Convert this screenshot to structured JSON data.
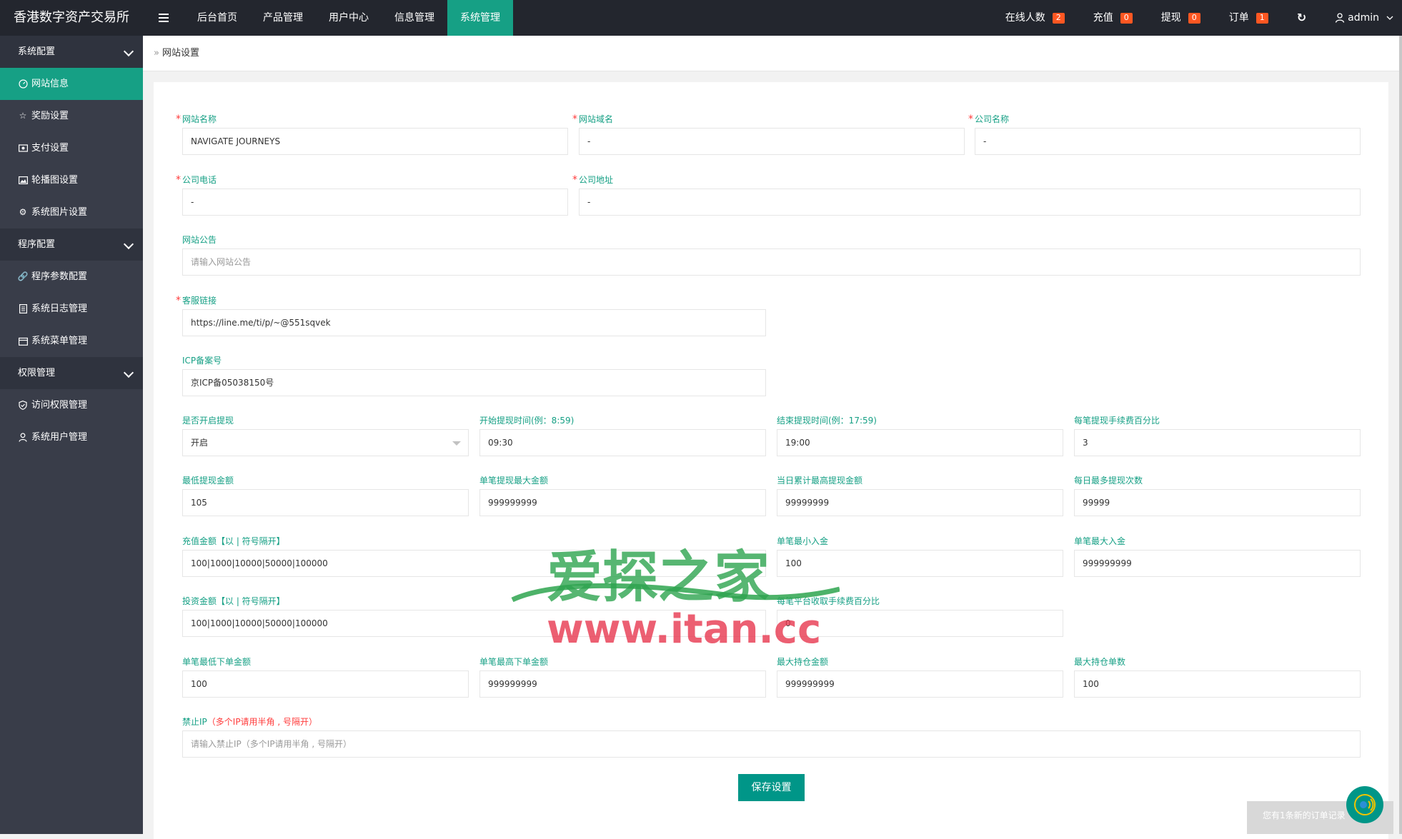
{
  "app": {
    "title": "香港数字资产交易所"
  },
  "topnav": {
    "items": [
      {
        "label": "后台首页"
      },
      {
        "label": "产品管理"
      },
      {
        "label": "用户中心"
      },
      {
        "label": "信息管理"
      },
      {
        "label": "系统管理",
        "active": true
      }
    ]
  },
  "topright": {
    "online": {
      "label": "在线人数",
      "count": "2"
    },
    "recharge": {
      "label": "充值",
      "count": "0"
    },
    "withdraw": {
      "label": "提现",
      "count": "0"
    },
    "orders": {
      "label": "订单",
      "count": "1"
    },
    "user": "admin"
  },
  "sidebar": {
    "groups": [
      {
        "label": "系统配置",
        "items": [
          "网站信息",
          "奖励设置",
          "支付设置",
          "轮播图设置",
          "系统图片设置"
        ]
      },
      {
        "label": "程序配置",
        "items": [
          "程序参数配置",
          "系统日志管理",
          "系统菜单管理"
        ]
      },
      {
        "label": "权限管理",
        "items": [
          "访问权限管理",
          "系统用户管理"
        ]
      }
    ]
  },
  "breadcrumb": "网站设置",
  "form": {
    "site_name": {
      "label": "网站名称",
      "value": "NAVIGATE JOURNEYS"
    },
    "site_domain": {
      "label": "网站域名",
      "value": "-"
    },
    "company_name": {
      "label": "公司名称",
      "value": "-"
    },
    "company_phone": {
      "label": "公司电话",
      "value": "-"
    },
    "company_address": {
      "label": "公司地址",
      "value": "-"
    },
    "announcement": {
      "label": "网站公告",
      "placeholder": "请输入网站公告"
    },
    "service_link": {
      "label": "客服链接",
      "value": "https://line.me/ti/p/~@551sqvek"
    },
    "icp": {
      "label": "ICP备案号",
      "value": "京ICP备05038150号"
    },
    "withdraw_enabled": {
      "label": "是否开启提现",
      "value": "开启"
    },
    "withdraw_start": {
      "label": "开始提现时间(例：8:59)",
      "value": "09:30"
    },
    "withdraw_end": {
      "label": "结束提现时间(例：17:59)",
      "value": "19:00"
    },
    "withdraw_fee": {
      "label": "每笔提现手续费百分比",
      "value": "3"
    },
    "min_withdraw": {
      "label": "最低提现金额",
      "value": "105"
    },
    "max_withdraw": {
      "label": "单笔提现最大金额",
      "value": "999999999"
    },
    "daily_max_withdraw": {
      "label": "当日累计最高提现金额",
      "value": "99999999"
    },
    "daily_withdraw_count": {
      "label": "每日最多提现次数",
      "value": "99999"
    },
    "recharge_amounts": {
      "label": "充值金额【以 | 符号隔开】",
      "value": "100|1000|10000|50000|100000"
    },
    "min_deposit": {
      "label": "单笔最小入金",
      "value": "100"
    },
    "max_deposit": {
      "label": "单笔最大入金",
      "value": "999999999"
    },
    "invest_amounts": {
      "label": "投资金额【以 | 符号隔开】",
      "value": "100|1000|10000|50000|100000"
    },
    "platform_fee": {
      "label": "每笔平台收取手续费百分比",
      "value": "0"
    },
    "min_order": {
      "label": "单笔最低下单金额",
      "value": "100"
    },
    "max_order": {
      "label": "单笔最高下单金额",
      "value": "999999999"
    },
    "max_position": {
      "label": "最大持仓金额",
      "value": "999999999"
    },
    "max_position_count": {
      "label": "最大持仓单数",
      "value": "100"
    },
    "banned_ip": {
      "label_green": "禁止IP",
      "label_red": "（多个IP请用半角 , 号隔开）",
      "placeholder": "请输入禁止IP（多个IP请用半角 , 号隔开）"
    },
    "save_label": "保存设置"
  },
  "watermark": {
    "title": "爱探之家",
    "url": "www.itan.cc"
  },
  "notice": "您有1条新的订单记录"
}
